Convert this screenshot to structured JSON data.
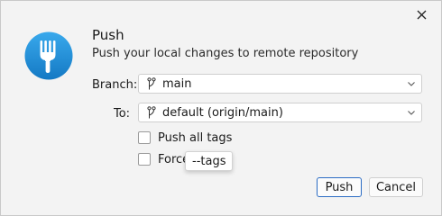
{
  "dialog": {
    "title": "Push",
    "subtitle": "Push your local changes to remote repository"
  },
  "form": {
    "branch": {
      "label": "Branch:",
      "value": "main"
    },
    "to": {
      "label": "To:",
      "value": "default (origin/main)"
    },
    "options": [
      {
        "label": "Push all tags",
        "checked": false
      },
      {
        "label": "Force",
        "checked": false
      }
    ]
  },
  "tooltip": {
    "text": "--tags"
  },
  "buttons": {
    "push": "Push",
    "cancel": "Cancel"
  },
  "icons": {
    "app": "fork-icon",
    "close": "close-icon",
    "branch": "branch-icon",
    "dropdown": "chevron-down-icon"
  },
  "colors": {
    "app_icon_blue": "#1f8fd6",
    "primary_button_border": "#2b6cc4"
  }
}
